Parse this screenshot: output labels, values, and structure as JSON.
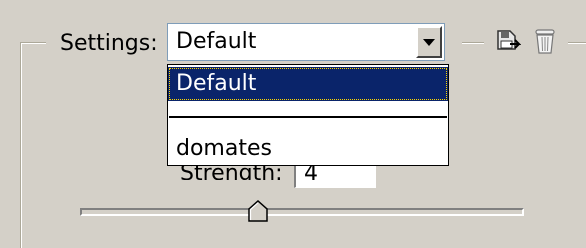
{
  "settings": {
    "label": "Settings:",
    "selected_value": "Default"
  },
  "dropdown": {
    "options": [
      "Default",
      "",
      "domates"
    ]
  },
  "strength": {
    "label": "Strength:",
    "value": "4"
  },
  "slider": {
    "level": 0.4
  },
  "icons": {
    "save": "save-preset-icon",
    "delete": "trash-icon"
  }
}
